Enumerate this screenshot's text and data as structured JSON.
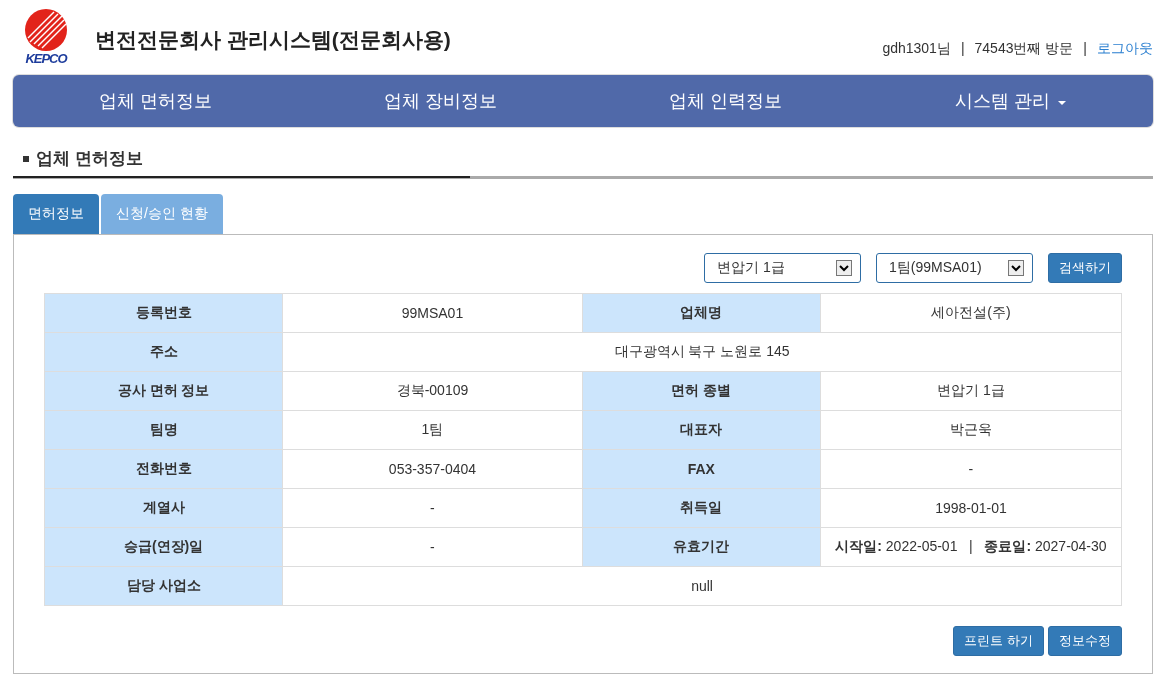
{
  "header": {
    "logo_text": "KEPCO",
    "title": "변전전문회사 관리시스템(전문회사용)",
    "user": "gdh1301님",
    "separator": "|",
    "visits": "74543번째 방문",
    "separator_2": "|",
    "logout": "로그아웃"
  },
  "nav": [
    {
      "label": "업체 면허정보",
      "dropdown": false
    },
    {
      "label": "업체 장비정보",
      "dropdown": false
    },
    {
      "label": "업체 인력정보",
      "dropdown": false
    },
    {
      "label": "시스템 관리",
      "dropdown": true
    }
  ],
  "page_title": "업체 면허정보",
  "tabs": [
    {
      "label": "면허정보",
      "selected": true
    },
    {
      "label": "신청/승인 현황",
      "selected": false
    }
  ],
  "filters": {
    "selects": [
      {
        "value": "변압기 1급"
      },
      {
        "value": "1팀(99MSA01)"
      }
    ],
    "search_button": "검색하기"
  },
  "table": {
    "rows": [
      {
        "cells": [
          {
            "label": "등록번호",
            "value": "99MSA01"
          },
          {
            "label": "업체명",
            "value": "세아전설(주)"
          }
        ]
      },
      {
        "cells": [
          {
            "label": "주소",
            "value": "대구광역시 북구 노원로 145"
          }
        ]
      },
      {
        "cells": [
          {
            "label": "공사 면허 정보",
            "value": "경북-00109"
          },
          {
            "label": "면허 종별",
            "value": "변압기 1급"
          }
        ]
      },
      {
        "cells": [
          {
            "label": "팀명",
            "value": "1팀"
          },
          {
            "label": "대표자",
            "value": "박근욱"
          }
        ]
      },
      {
        "cells": [
          {
            "label": "전화번호",
            "value": "053-357-0404"
          },
          {
            "label": "FAX",
            "value": "-"
          }
        ]
      },
      {
        "cells": [
          {
            "label": "계열사",
            "value": "-"
          },
          {
            "label": "취득일",
            "value": "1998-01-01"
          }
        ]
      },
      {
        "cells": [
          {
            "label": "승급(연장)일",
            "value": "-"
          },
          {
            "label": "유효기간",
            "value": "**시작일:** 2022-05-01   |   **종료일:** 2027-04-30"
          }
        ]
      },
      {
        "cells": [
          {
            "label": "담당 사업소",
            "value": "null"
          }
        ]
      }
    ]
  },
  "actions": [
    "프린트 하기",
    "정보수정"
  ]
}
